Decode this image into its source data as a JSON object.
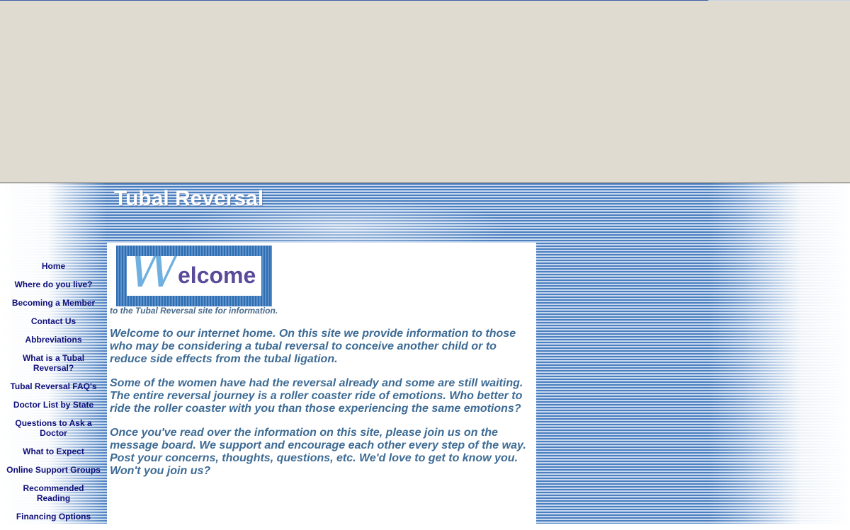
{
  "header": {
    "title": "Tubal Reversal"
  },
  "welcome": {
    "logo_first_letter": "W",
    "logo_rest": "elcome",
    "tagline": "to the Tubal Reversal site for information."
  },
  "content": {
    "paragraphs": [
      "Welcome to our internet home.  On this site we provide information to those who may be considering a tubal reversal to conceive another child or to reduce side effects from the tubal ligation.",
      "Some of the women have had the reversal already and some are still waiting.  The entire reversal journey is a roller coaster ride of emotions.  Who better to ride the roller coaster with you than those experiencing the same emotions?",
      "Once you've read over the information on this site, please join us on the message board.  We support and encourage each other every step of the way.  Post your concerns, thoughts, questions, etc.  We'd love to get to know you.  Won't you join us?"
    ]
  },
  "nav": {
    "items": [
      {
        "label": "Home"
      },
      {
        "label": "Where do you live?"
      },
      {
        "label": "Becoming a Member"
      },
      {
        "label": "Contact Us"
      },
      {
        "label": "Abbreviations"
      },
      {
        "label": "What is a Tubal Reversal?"
      },
      {
        "label": "Tubal Reversal FAQ's"
      },
      {
        "label": "Doctor List by State"
      },
      {
        "label": "Questions to Ask a Doctor"
      },
      {
        "label": "What to Expect"
      },
      {
        "label": "Online Support Groups"
      },
      {
        "label": "Recommended Reading"
      },
      {
        "label": "Financing Options"
      }
    ]
  },
  "colors": {
    "top_band": "#dfdbd0",
    "stripe_dark": "#4b7fc0",
    "stripe_light": "#c7d8ee",
    "nav_link": "#10107a",
    "body_text": "#3d6b94",
    "logo_w": "#6fb0e0",
    "logo_text": "#5a4a9a"
  }
}
